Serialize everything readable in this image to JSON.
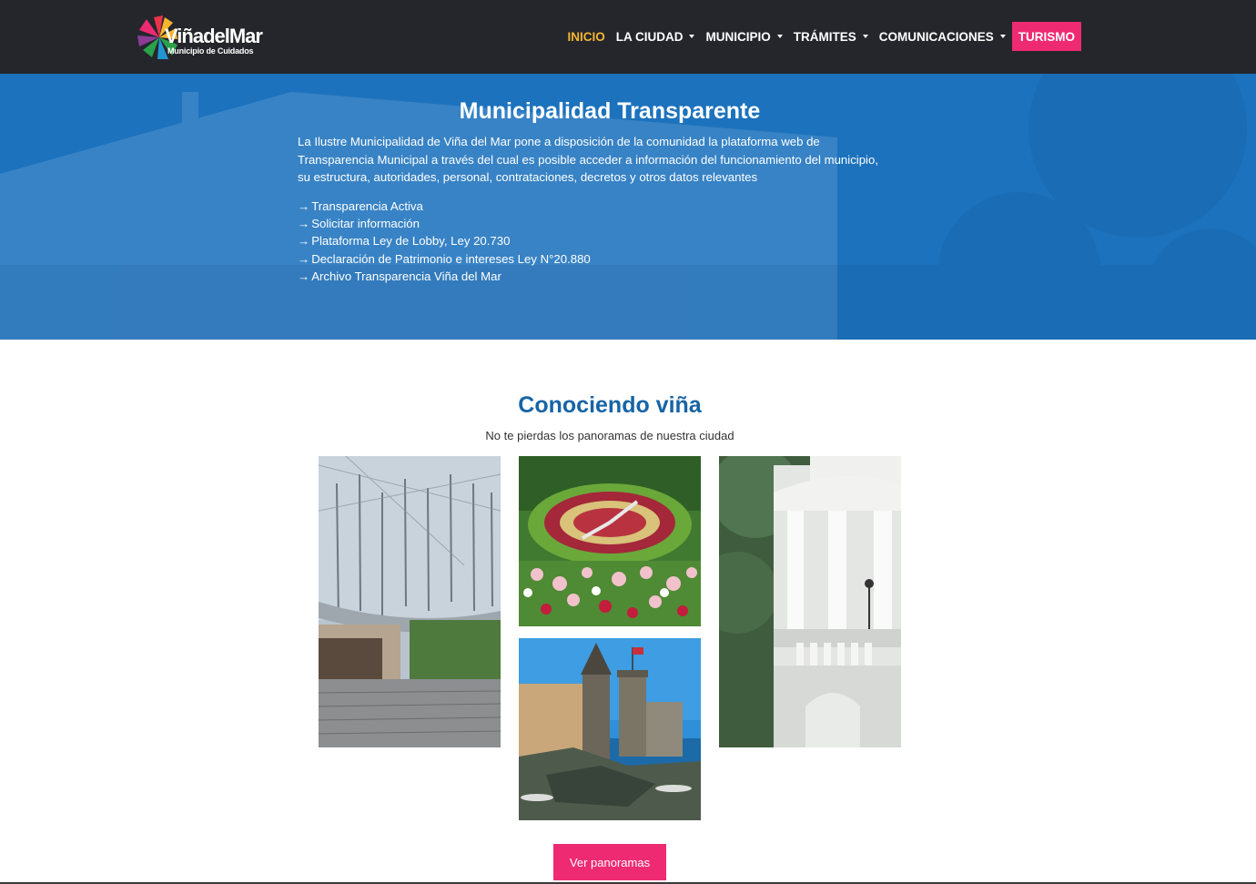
{
  "brand": {
    "logo_main": "ViñadelMar",
    "logo_sub": "Municipio de Cuidados",
    "logo_colors": [
      "#e7344b",
      "#f7b52c",
      "#2aa14a",
      "#2296d3",
      "#8a3c96",
      "#ee2a73"
    ]
  },
  "nav": {
    "items": [
      {
        "label": "INICIO",
        "active": true,
        "dropdown": false
      },
      {
        "label": "LA CIUDAD",
        "dropdown": true
      },
      {
        "label": "MUNICIPIO",
        "dropdown": true
      },
      {
        "label": "TRÁMITES",
        "dropdown": true
      },
      {
        "label": "COMUNICACIONES",
        "dropdown": true
      },
      {
        "label": "TURISMO",
        "highlight": true
      }
    ]
  },
  "hero": {
    "title": "Municipalidad Transparente",
    "description": "La Ilustre Municipalidad de Viña del Mar pone a disposición de la comunidad la plataforma web de Transparencia Municipal a través del cual es posible acceder a información del funcionamiento del municipio, su estructura, autoridades, personal, contrataciones, decretos y otros datos relevantes",
    "arrow": "→",
    "links": [
      "Transparencia Activa",
      " Solicitar información",
      " Plataforma Ley de Lobby, Ley 20.730",
      " Declaración de Patrimonio e intereses Ley N°20.880",
      " Archivo Transparencia Viña del Mar"
    ]
  },
  "section": {
    "title": "Conociendo viña",
    "subtitle": "No te pierdas los panoramas de nuestra ciudad",
    "photos": [
      {
        "subject": "amphitheater-photo"
      },
      {
        "subject": "flower-clock-photo"
      },
      {
        "subject": "wulff-castle-photo"
      },
      {
        "subject": "white-palace-photo"
      }
    ],
    "button": "Ver panoramas"
  },
  "colors": {
    "navbar_bg": "#25262b",
    "active": "#f5b731",
    "accent": "#ee2a73",
    "hero_bg": "#1c72bd",
    "section_title": "#1764a6"
  }
}
